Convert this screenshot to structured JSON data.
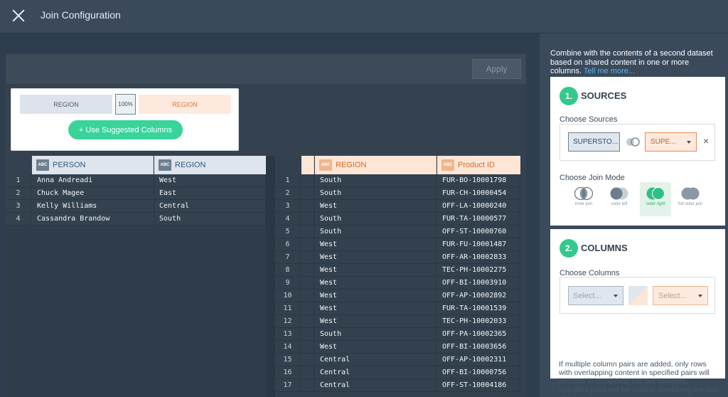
{
  "header": {
    "title": "Join Configuration",
    "close_icon": "close-icon"
  },
  "toolbar": {
    "apply_label": "Apply"
  },
  "match": {
    "left_column": "REGION",
    "match_percent": "100%",
    "right_column": "REGION",
    "suggest_label": "+ Use Suggested Columns"
  },
  "left_table": {
    "columns": [
      "PERSON",
      "REGION"
    ],
    "type_badge": "ABC",
    "rows": [
      [
        "1",
        "Anna Andreadi",
        "West"
      ],
      [
        "2",
        "Chuck Magee",
        "East"
      ],
      [
        "3",
        "Kelly Williams",
        "Central"
      ],
      [
        "4",
        "Cassandra Brandow",
        "South"
      ]
    ]
  },
  "right_table": {
    "columns": [
      "REGION",
      "Product ID"
    ],
    "type_badge": "ABC",
    "rows": [
      [
        "1",
        "South",
        "FUR-BO-10001798"
      ],
      [
        "2",
        "South",
        "FUR-CH-10000454"
      ],
      [
        "3",
        "West",
        "OFF-LA-10000240"
      ],
      [
        "4",
        "South",
        "FUR-TA-10000577"
      ],
      [
        "5",
        "South",
        "OFF-ST-10000760"
      ],
      [
        "6",
        "West",
        "FUR-FU-10001487"
      ],
      [
        "7",
        "West",
        "OFF-AR-10002833"
      ],
      [
        "8",
        "West",
        "TEC-PH-10002275"
      ],
      [
        "9",
        "West",
        "OFF-BI-10003910"
      ],
      [
        "10",
        "West",
        "OFF-AP-10002892"
      ],
      [
        "11",
        "West",
        "FUR-TA-10001539"
      ],
      [
        "12",
        "West",
        "TEC-PH-10002033"
      ],
      [
        "13",
        "South",
        "OFF-PA-10002365"
      ],
      [
        "14",
        "West",
        "OFF-BI-10003656"
      ],
      [
        "15",
        "Central",
        "OFF-AP-10002311"
      ],
      [
        "16",
        "Central",
        "OFF-BI-10000756"
      ],
      [
        "17",
        "Central",
        "OFF-ST-10004186"
      ]
    ]
  },
  "side": {
    "description": "Combine with the contents of a second dataset based on shared content in one or more columns.",
    "tell_me_more": "Tell me more...",
    "sources": {
      "step": "1.",
      "title": "SOURCES",
      "choose_label": "Choose Sources",
      "left_source": "SUPERSTO...",
      "right_source": "SUPE...",
      "remove_icon": "×",
      "join_mode_label": "Choose Join Mode",
      "join_modes": [
        "inner join",
        "outer left",
        "outer right",
        "full outer join"
      ],
      "selected_join_mode": "outer right"
    },
    "columns": {
      "step": "2.",
      "title": "COLUMNS",
      "choose_label": "Choose Columns",
      "left_placeholder": "Select...",
      "right_placeholder": "Select...",
      "note": "If multiple column pairs are added, only rows with overlapping content in specified pairs will be used in combining the two datasets. specified pairs will be used in combining the two datasets."
    }
  },
  "colors": {
    "accent_green": "#3ad39a",
    "left_accent": "#2f5a86",
    "right_accent": "#d8692e"
  }
}
